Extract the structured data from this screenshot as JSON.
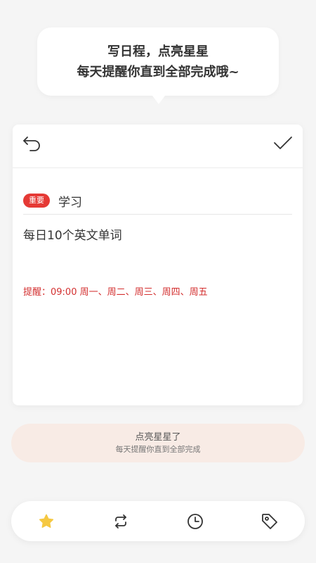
{
  "bubble": {
    "line1": "写日程，点亮星星",
    "line2": "每天提醒你直到全部完成哦~"
  },
  "editor": {
    "badge": "重要",
    "category": "学习",
    "task_text": "每日10个英文单词",
    "reminder": "提醒：09:00 周一、周二、周三、周四、周五"
  },
  "tip": {
    "title": "点亮星星了",
    "subtitle": "每天提醒你直到全部完成"
  },
  "nav": {
    "items": [
      {
        "icon": "star-icon",
        "active": true
      },
      {
        "icon": "repeat-icon",
        "active": false
      },
      {
        "icon": "clock-icon",
        "active": false
      },
      {
        "icon": "tag-icon",
        "active": false
      }
    ]
  },
  "colors": {
    "accent_red": "#e53935",
    "reminder_red": "#d32f2f",
    "star_yellow": "#f5c842",
    "tip_bg": "#f8ebe5",
    "page_bg": "#f5f5f5"
  }
}
